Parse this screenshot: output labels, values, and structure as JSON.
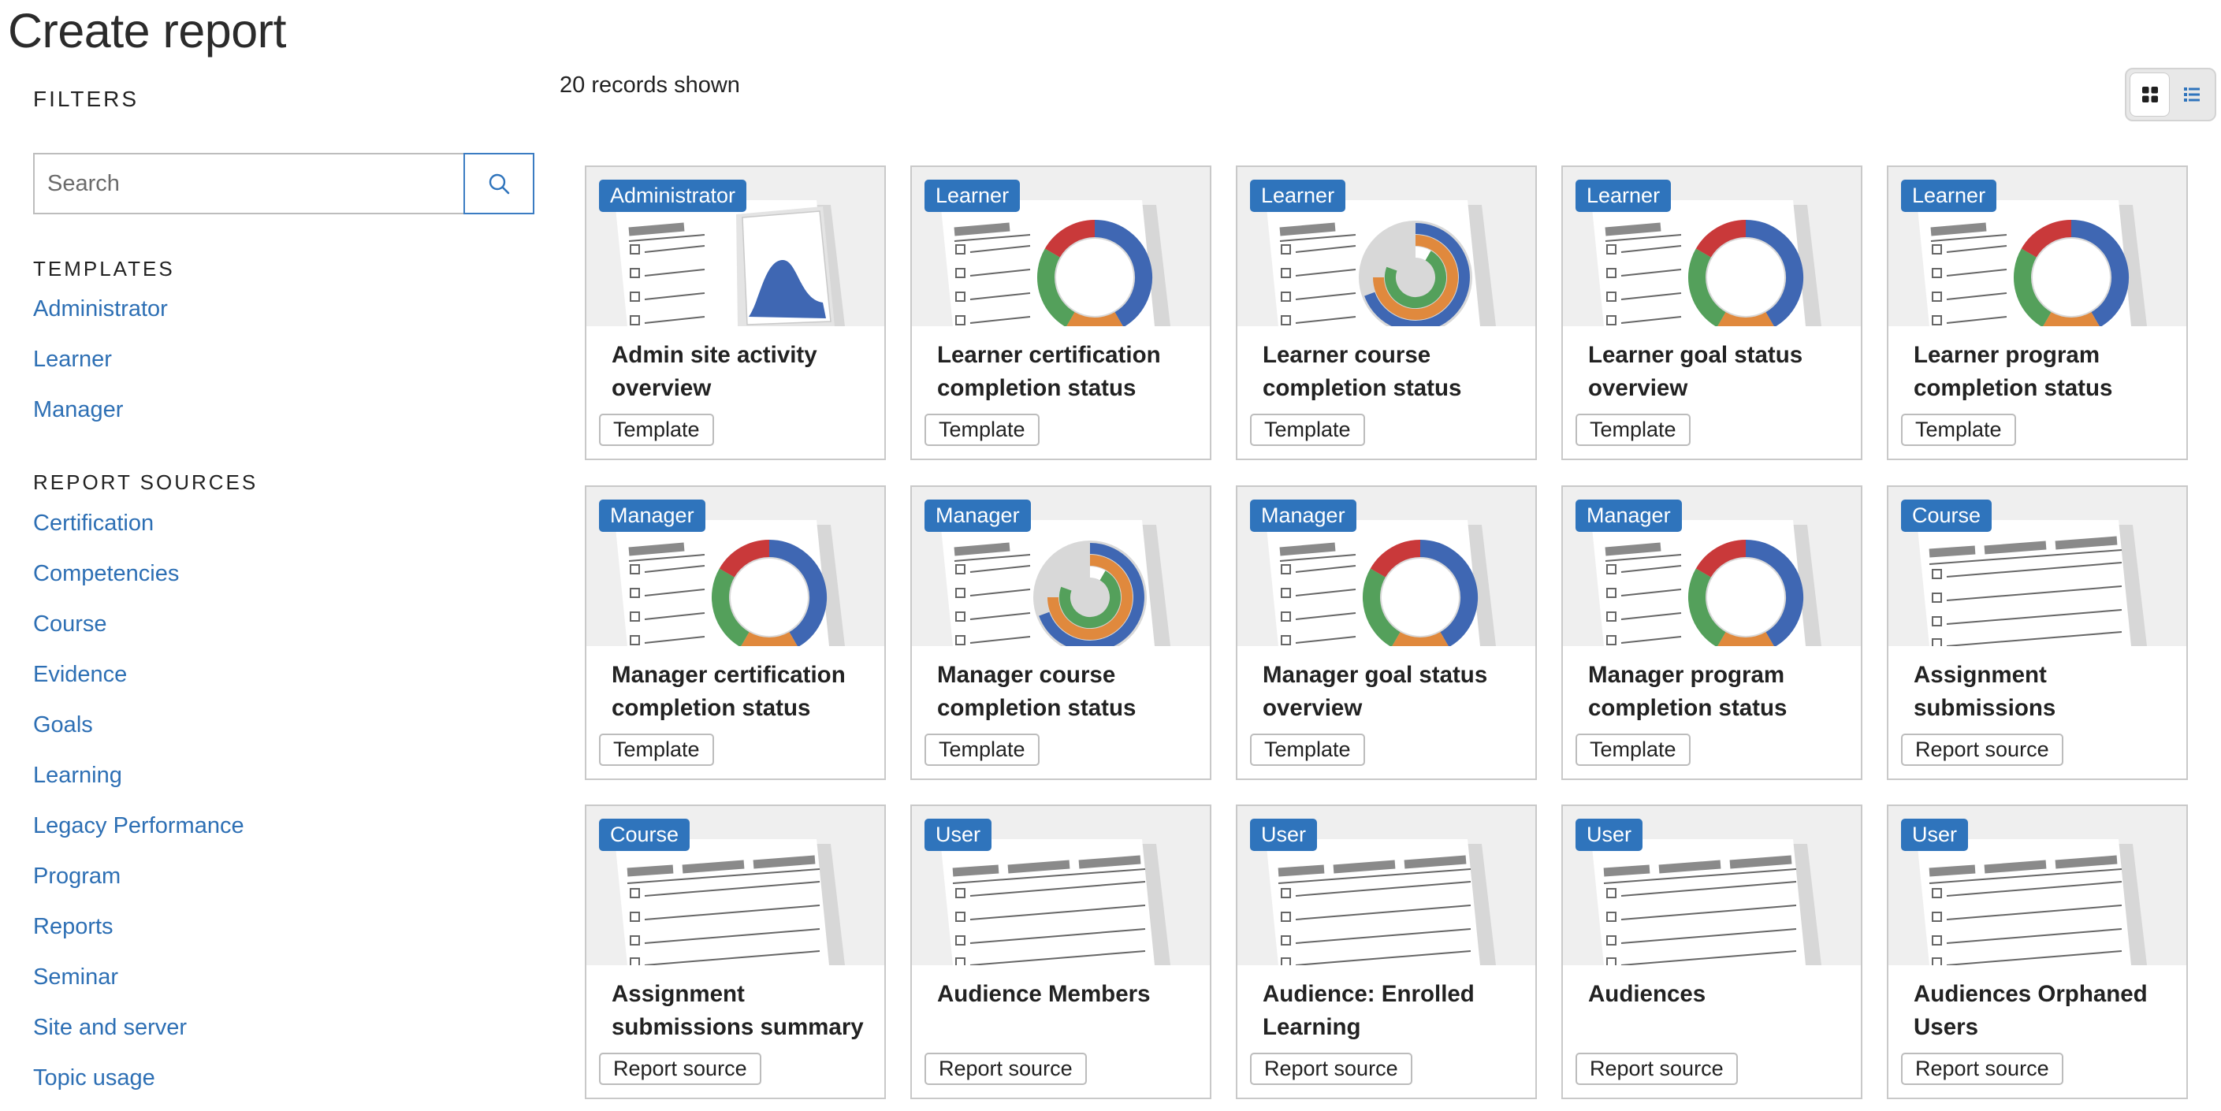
{
  "page": {
    "title": "Create report"
  },
  "filters": {
    "heading": "FILTERS",
    "search_placeholder": "Search"
  },
  "templates": {
    "heading": "TEMPLATES",
    "items": [
      "Administrator",
      "Learner",
      "Manager"
    ]
  },
  "report_sources": {
    "heading": "REPORT SOURCES",
    "items": [
      "Certification",
      "Competencies",
      "Course",
      "Evidence",
      "Goals",
      "Learning",
      "Legacy Performance",
      "Program",
      "Reports",
      "Seminar",
      "Site and server",
      "Topic usage"
    ]
  },
  "results": {
    "count_text": "20 records shown"
  },
  "view_toggle": {
    "options": [
      "grid-view-icon",
      "list-view-icon"
    ],
    "active": "grid-view-icon"
  },
  "colors": {
    "accent": "#2f74bc",
    "link": "#2d6fb4",
    "chart_blue": "#3f67b3",
    "chart_green": "#54a05b",
    "chart_red": "#c9393a",
    "chart_orange": "#e0893d"
  },
  "cards": [
    {
      "badge": "Administrator",
      "title": "Admin site activity overview",
      "tag": "Template",
      "thumb": "area-chart"
    },
    {
      "badge": "Learner",
      "title": "Learner certification completion status",
      "tag": "Template",
      "thumb": "donut-chart"
    },
    {
      "badge": "Learner",
      "title": "Learner course completion status",
      "tag": "Template",
      "thumb": "radial-chart"
    },
    {
      "badge": "Learner",
      "title": "Learner goal status overview",
      "tag": "Template",
      "thumb": "donut-chart"
    },
    {
      "badge": "Learner",
      "title": "Learner program completion status",
      "tag": "Template",
      "thumb": "donut-chart"
    },
    {
      "badge": "Manager",
      "title": "Manager certification completion status",
      "tag": "Template",
      "thumb": "donut-chart"
    },
    {
      "badge": "Manager",
      "title": "Manager course completion status",
      "tag": "Template",
      "thumb": "radial-chart"
    },
    {
      "badge": "Manager",
      "title": "Manager goal status overview",
      "tag": "Template",
      "thumb": "donut-chart"
    },
    {
      "badge": "Manager",
      "title": "Manager program completion status",
      "tag": "Template",
      "thumb": "donut-chart"
    },
    {
      "badge": "Course",
      "title": "Assignment submissions",
      "tag": "Report source",
      "thumb": "table"
    },
    {
      "badge": "Course",
      "title": "Assignment submissions summary",
      "tag": "Report source",
      "thumb": "table"
    },
    {
      "badge": "User",
      "title": "Audience Members",
      "tag": "Report source",
      "thumb": "table"
    },
    {
      "badge": "User",
      "title": "Audience: Enrolled Learning",
      "tag": "Report source",
      "thumb": "table"
    },
    {
      "badge": "User",
      "title": "Audiences",
      "tag": "Report source",
      "thumb": "table"
    },
    {
      "badge": "User",
      "title": "Audiences Orphaned Users",
      "tag": "Report source",
      "thumb": "table"
    }
  ]
}
